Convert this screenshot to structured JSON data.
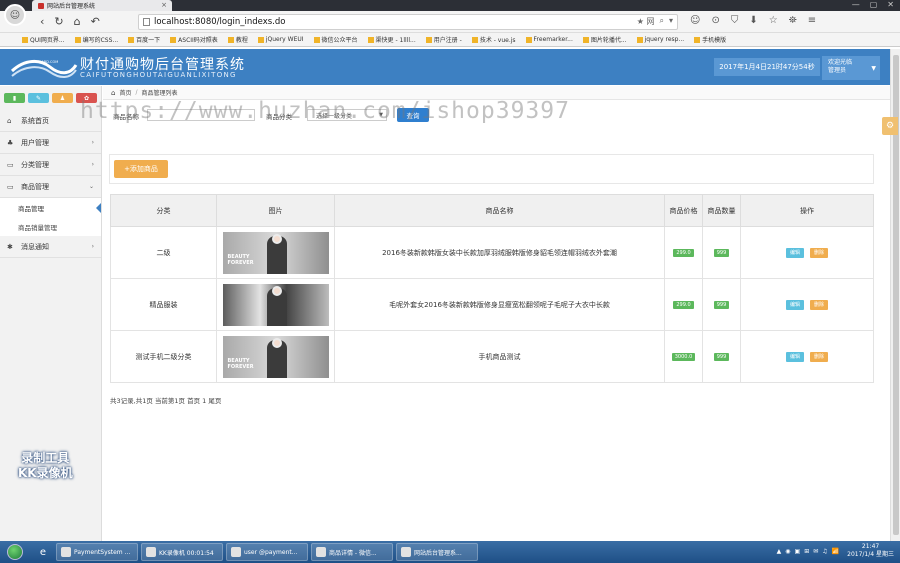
{
  "browser": {
    "tab_title": "网站后台管理系统",
    "tab_close": "×",
    "window_controls": [
      "—",
      "▢",
      "✕"
    ],
    "nav_icons": [
      "‹",
      "↻",
      "⌂",
      "↶"
    ],
    "url": "localhost:8080/login_indexs.do",
    "url_right": [
      "★ 网",
      "⌕",
      "▾"
    ],
    "toolbar_icons": [
      "☺",
      "⊙",
      "⛉",
      "⬇",
      "☆",
      "⛯",
      "≡"
    ],
    "bookmarks": [
      "QUI网页界...",
      "编写的CSS...",
      "百度一下",
      "ASCII码对照表",
      "教程",
      "jQuery WEUI",
      "微信公众平台",
      "渠快更 - 1llll...",
      "用户注册 -",
      "技术 - vue.js",
      "Freemarker...",
      "图片轮播代...",
      "jquery resp...",
      "手机模版"
    ]
  },
  "app": {
    "title": "财付通购物后台管理系统",
    "subtitle": "CAIFUTONGHOUTAIGUANLIXITONG",
    "logo_text": "SELLBOARD.COM",
    "datetime": "2017年1月4日21时47分54秒",
    "user_welcome": "欢迎光临",
    "user_role": "管理员"
  },
  "sidebar": {
    "quick_buttons": [
      {
        "label": "▮",
        "color": "#5cb85c"
      },
      {
        "label": "✎",
        "color": "#5bc0de"
      },
      {
        "label": "♟",
        "color": "#f0ad4e"
      },
      {
        "label": "✿",
        "color": "#d9534f"
      }
    ],
    "items": [
      {
        "icon": "⌂",
        "label": "系统首页",
        "arrow": ""
      },
      {
        "icon": "♣",
        "label": "用户管理",
        "arrow": "›"
      },
      {
        "icon": "▭",
        "label": "分类管理",
        "arrow": "›"
      },
      {
        "icon": "▭",
        "label": "商品管理",
        "arrow": "⌄"
      }
    ],
    "sub_items": [
      "商品管理",
      "商品销量管理"
    ],
    "last_item": {
      "icon": "✱",
      "label": "消息通知",
      "arrow": "›"
    }
  },
  "main": {
    "breadcrumb_home": "首页",
    "breadcrumb_current": "商品管理列表",
    "search": {
      "name_label": "商品名称",
      "name_value": "",
      "category_label": "商品分类",
      "category_selected": "选择一级分类",
      "query_button": "查询"
    },
    "add_button": "+添加商品",
    "columns": [
      "分类",
      "图片",
      "商品名称",
      "商品价格",
      "商品数量",
      "操作"
    ],
    "rows": [
      {
        "category": "二级",
        "name": "2016冬装新款韩版女装中长款加厚羽绒服韩版修身貂毛领连帽羽绒衣外套潮",
        "price": "299.0",
        "qty": "999",
        "img_text": "BEAUTY\nFOREVER",
        "img_style": "light"
      },
      {
        "category": "精品服装",
        "name": "毛呢外套女2016冬装新款韩版修身显瘦宽松翻领呢子毛呢子大衣中长款",
        "price": "299.0",
        "qty": "999",
        "img_text": "",
        "img_style": "dark"
      },
      {
        "category": "测试手机二级分类",
        "name": "手机商品测试",
        "price": "3000.0",
        "qty": "999",
        "img_text": "BEAUTY\nFOREVER",
        "img_style": "light"
      }
    ],
    "edit_label": "编辑",
    "delete_label": "删除",
    "pager": "共3记录,共1页 当前第1页 首页 1 尾页"
  },
  "overlay": {
    "watermark": "https://www.huzhan.com/ishop39397",
    "recorder_line1": "录制工具",
    "recorder_line2": "KK录像机",
    "settings_icon": "⚙"
  },
  "taskbar": {
    "items": [
      "PaymentSystem ...",
      "KK录像机 00:01:54",
      "user @payment...",
      "商品详情 - 微信...",
      "网站后台管理系..."
    ],
    "tray_icons": [
      "▲",
      "◉",
      "▣",
      "⊞",
      "✉",
      "♫",
      "📶"
    ],
    "time": "21:47",
    "date": "2017/1/4 星期三",
    "accent": "#3d80c2"
  }
}
